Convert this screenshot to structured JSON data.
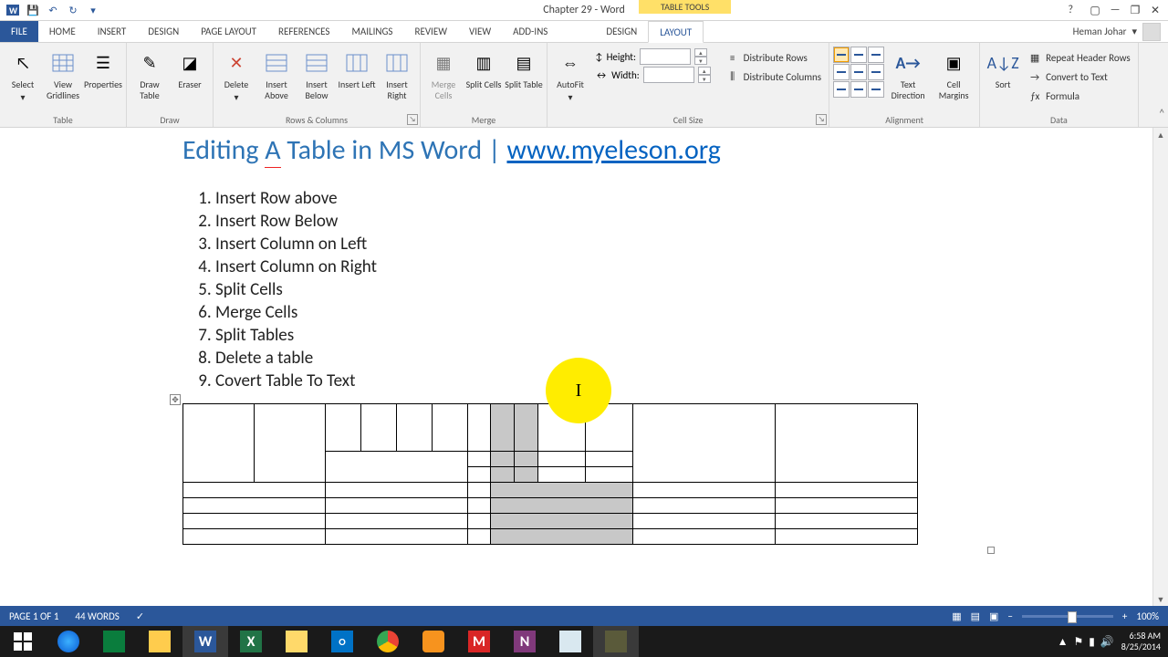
{
  "title": "Chapter 29 - Word",
  "table_tools_label": "TABLE TOOLS",
  "user_name": "Heman Johar",
  "tabs": {
    "file": "FILE",
    "home": "HOME",
    "insert": "INSERT",
    "design": "DESIGN",
    "page_layout": "PAGE LAYOUT",
    "references": "REFERENCES",
    "mailings": "MAILINGS",
    "review": "REVIEW",
    "view": "VIEW",
    "addins": "ADD-INS",
    "tt_design": "DESIGN",
    "tt_layout": "LAYOUT"
  },
  "ribbon": {
    "table": {
      "label": "Table",
      "select": "Select",
      "view_gridlines": "View Gridlines",
      "properties": "Properties"
    },
    "draw": {
      "label": "Draw",
      "draw_table": "Draw Table",
      "eraser": "Eraser"
    },
    "rows_cols": {
      "label": "Rows & Columns",
      "delete": "Delete",
      "insert_above": "Insert Above",
      "insert_below": "Insert Below",
      "insert_left": "Insert Left",
      "insert_right": "Insert Right"
    },
    "merge": {
      "label": "Merge",
      "merge_cells": "Merge Cells",
      "split_cells": "Split Cells",
      "split_table": "Split Table"
    },
    "cell_size": {
      "label": "Cell Size",
      "autofit": "AutoFit",
      "height": "Height:",
      "width": "Width:",
      "height_val": "",
      "width_val": "",
      "dist_rows": "Distribute Rows",
      "dist_cols": "Distribute Columns"
    },
    "alignment": {
      "label": "Alignment",
      "text_direction": "Text Direction",
      "cell_margins": "Cell Margins"
    },
    "data": {
      "label": "Data",
      "sort": "Sort",
      "repeat_header": "Repeat Header Rows",
      "convert_text": "Convert to Text",
      "formula": "Formula"
    }
  },
  "document": {
    "heading_prefix": "Editing ",
    "heading_a": "A",
    "heading_mid": " Table in MS Word | ",
    "heading_link": "www.myeleson.org",
    "list": [
      "Insert Row above",
      "Insert Row Below",
      "Insert Column on Left",
      "Insert Column on Right",
      "Split Cells",
      "Merge Cells",
      "Split Tables",
      "Delete a table",
      "Covert Table To Text"
    ]
  },
  "status": {
    "page": "PAGE 1 OF 1",
    "words": "44 WORDS",
    "zoom": "100%"
  },
  "clock": {
    "time": "6:58 AM",
    "date": "8/25/2014"
  }
}
